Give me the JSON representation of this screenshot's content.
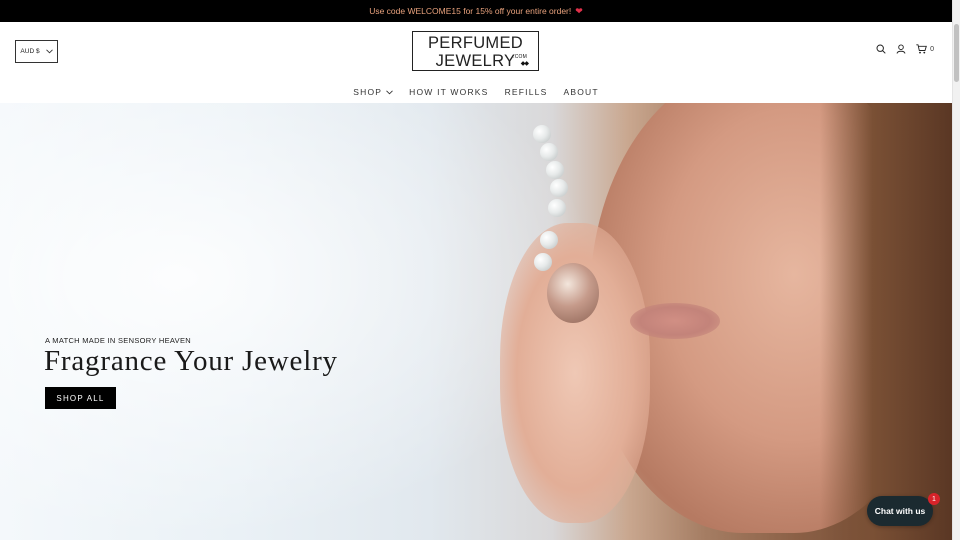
{
  "announcement": {
    "text": "Use code WELCOME15 for 15% off your entire order!",
    "emoji_icon": "heart-gem-icon"
  },
  "header": {
    "currency": {
      "selected": "AUD $"
    },
    "logo": {
      "line1": "PERFUMED",
      "line2": "JEWELRY",
      "suffix": ".COM"
    },
    "icons": [
      "search-icon",
      "account-icon",
      "cart-icon"
    ],
    "cart_count": "0"
  },
  "nav": {
    "items": [
      {
        "label": "SHOP",
        "has_dropdown": true
      },
      {
        "label": "HOW IT WORKS"
      },
      {
        "label": "REFILLS"
      },
      {
        "label": "ABOUT"
      }
    ]
  },
  "hero": {
    "tagline": "A MATCH MADE IN SENSORY HEAVEN",
    "headline": "Fragrance Your Jewelry",
    "cta": "SHOP ALL"
  },
  "chat": {
    "label": "Chat with us",
    "badge": "1"
  },
  "colors": {
    "announcement_bg": "#000000",
    "announcement_text": "#e9a27d",
    "cta_bg": "#000000",
    "chat_bg": "#1b2a30",
    "badge": "#d8232a"
  }
}
